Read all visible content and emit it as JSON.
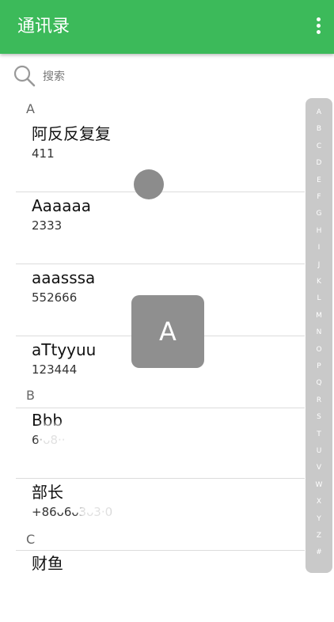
{
  "app_bar": {
    "title": "通讯录",
    "menu_icon": "more-vert-icon",
    "color": "#3cba5a"
  },
  "search": {
    "placeholder": "搜索",
    "value": "",
    "icon": "search-icon"
  },
  "sections": [
    {
      "letter": "A"
    },
    {
      "letter": "B"
    },
    {
      "letter": "C"
    }
  ],
  "contacts": [
    {
      "name": "阿反反复复",
      "phone": "411"
    },
    {
      "name": "Aaaaaa",
      "phone": "2333"
    },
    {
      "name": "aaasssa",
      "phone": "552666"
    },
    {
      "name": "aTtyyuu",
      "phone": "123444"
    },
    {
      "name": "Bbb",
      "phone": "6·ᴗ8··"
    },
    {
      "name": "部长",
      "phone": "+86ᴗ6ᴗ3ᴗ3·0"
    },
    {
      "name": "财鱼",
      "phone": ""
    }
  ],
  "letter_index": [
    "A",
    "B",
    "C",
    "D",
    "E",
    "F",
    "G",
    "H",
    "I",
    "J",
    "K",
    "L",
    "M",
    "N",
    "O",
    "P",
    "Q",
    "R",
    "S",
    "T",
    "U",
    "V",
    "W",
    "X",
    "Y",
    "Z",
    "#"
  ],
  "popup_letter": "A"
}
